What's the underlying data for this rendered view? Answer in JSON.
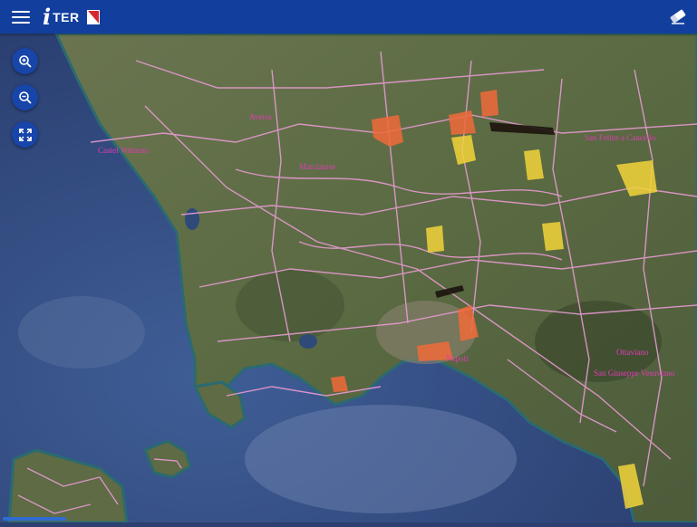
{
  "app": {
    "logo_letter": "i",
    "logo_text": "TER"
  },
  "icons": {
    "menu": "hamburger-menu-icon",
    "eraser": "eraser-icon",
    "zoom_in": "zoom-in-icon",
    "zoom_out": "zoom-out-icon",
    "fullscreen": "fullscreen-icon",
    "flag": "campania-flag-icon"
  },
  "colors": {
    "header": "#123f9e",
    "buttons": "#1745a8",
    "roads": "#e69ad1",
    "labels": "#e23bb4",
    "zones_orange": "#f06a3a",
    "zones_yellow": "#f2d33a"
  },
  "map": {
    "places": [
      {
        "id": "castel-volturno",
        "text": "Castel Volturno"
      },
      {
        "id": "san-felice",
        "text": "San Felice a Cancello"
      },
      {
        "id": "marcianise",
        "text": "Marcianise"
      },
      {
        "id": "aversa",
        "text": "Aversa"
      },
      {
        "id": "napoli",
        "text": "Napoli"
      },
      {
        "id": "ottaviano",
        "text": "Ottaviano"
      },
      {
        "id": "san-giuseppe",
        "text": "San Giuseppe Vesuviano"
      }
    ]
  }
}
